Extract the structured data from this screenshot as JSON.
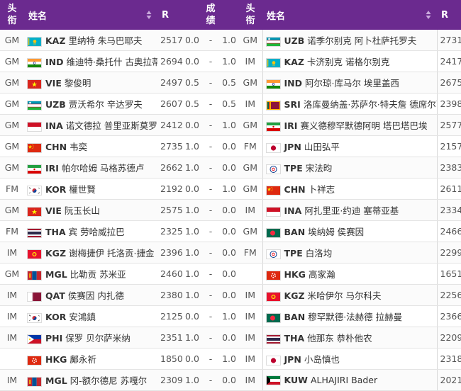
{
  "headers": {
    "title": "头衔",
    "name": "姓名",
    "rating": "R",
    "result": "成绩",
    "title2": "头衔",
    "name2": "姓名",
    "rating2": "R"
  },
  "rows": [
    {
      "w_title": "GM",
      "w_flag": "KAZ",
      "w_code": "KAZ",
      "w_name": "里纳特 朱马巴耶夫",
      "w_rating": "2517",
      "w_score": "0.0",
      "dash": "-",
      "b_score": "1.0",
      "b_title": "GM",
      "b_flag": "UZB",
      "b_code": "UZB",
      "b_name": "诺季尔别克 阿卜杜萨托罗夫",
      "b_rating": "2731"
    },
    {
      "w_title": "GM",
      "w_flag": "IND",
      "w_code": "IND",
      "w_name": "维迪特·桑托什 古奥拉蒂",
      "w_rating": "2694",
      "w_score": "0.0",
      "dash": "-",
      "b_score": "1.0",
      "b_title": "IM",
      "b_flag": "KAZ",
      "b_code": "KAZ",
      "b_name": "卡济别克 诺格尔别克",
      "b_rating": "2417"
    },
    {
      "w_title": "GM",
      "w_flag": "VIE",
      "w_code": "VIE",
      "w_name": "黎俊明",
      "w_rating": "2497",
      "w_score": "0.5",
      "dash": "-",
      "b_score": "0.5",
      "b_title": "GM",
      "b_flag": "IND",
      "b_code": "IND",
      "b_name": "阿尔琼·库马尔 埃里盖西",
      "b_rating": "2675"
    },
    {
      "w_title": "GM",
      "w_flag": "UZB",
      "w_code": "UZB",
      "w_name": "贾沃希尔 辛达罗夫",
      "w_rating": "2607",
      "w_score": "0.5",
      "dash": "-",
      "b_score": "0.5",
      "b_title": "IM",
      "b_flag": "SRI",
      "b_code": "SRI",
      "b_name": "洛库曼纳盖·苏萨尔·特夫詹 德席尔瓦",
      "b_rating": "2398"
    },
    {
      "w_title": "GM",
      "w_flag": "INA",
      "w_code": "INA",
      "w_name": "诺文德拉 普里亚斯莫罗",
      "w_rating": "2412",
      "w_score": "0.0",
      "dash": "-",
      "b_score": "1.0",
      "b_title": "GM",
      "b_flag": "IRI",
      "b_code": "IRI",
      "b_name": "赛义德穆罕默德阿明 塔巴塔巴埃",
      "b_rating": "2577"
    },
    {
      "w_title": "GM",
      "w_flag": "CHN",
      "w_code": "CHN",
      "w_name": "韦奕",
      "w_rating": "2735",
      "w_score": "1.0",
      "dash": "-",
      "b_score": "0.0",
      "b_title": "FM",
      "b_flag": "JPN",
      "b_code": "JPN",
      "b_name": "山田弘平",
      "b_rating": "2157"
    },
    {
      "w_title": "GM",
      "w_flag": "IRI",
      "w_code": "IRI",
      "w_name": "帕尔哈姆 马格苏德卢",
      "w_rating": "2662",
      "w_score": "1.0",
      "dash": "-",
      "b_score": "0.0",
      "b_title": "GM",
      "b_flag": "TPE",
      "b_code": "TPE",
      "b_name": "宋法昀",
      "b_rating": "2383"
    },
    {
      "w_title": "FM",
      "w_flag": "KOR",
      "w_code": "KOR",
      "w_name": "權世賢",
      "w_rating": "2192",
      "w_score": "0.0",
      "dash": "-",
      "b_score": "1.0",
      "b_title": "GM",
      "b_flag": "CHN",
      "b_code": "CHN",
      "b_name": "卜祥志",
      "b_rating": "2611"
    },
    {
      "w_title": "GM",
      "w_flag": "VIE",
      "w_code": "VIE",
      "w_name": "阮玉长山",
      "w_rating": "2575",
      "w_score": "1.0",
      "dash": "-",
      "b_score": "0.0",
      "b_title": "IM",
      "b_flag": "INA",
      "b_code": "INA",
      "b_name": "阿扎里亚·约迪 塞蒂亚基",
      "b_rating": "2334"
    },
    {
      "w_title": "FM",
      "w_flag": "THA",
      "w_code": "THA",
      "w_name": "宾 劳哈威拉巴",
      "w_rating": "2325",
      "w_score": "1.0",
      "dash": "-",
      "b_score": "0.0",
      "b_title": "GM",
      "b_flag": "BAN",
      "b_code": "BAN",
      "b_name": "埃纳姆 侯赛因",
      "b_rating": "2466"
    },
    {
      "w_title": "IM",
      "w_flag": "KGZ",
      "w_code": "KGZ",
      "w_name": "谢梅捷伊 托洛贡·捷金",
      "w_rating": "2396",
      "w_score": "1.0",
      "dash": "-",
      "b_score": "0.0",
      "b_title": "FM",
      "b_flag": "TPE",
      "b_code": "TPE",
      "b_name": "白洛均",
      "b_rating": "2299"
    },
    {
      "w_title": "GM",
      "w_flag": "MGL",
      "w_code": "MGL",
      "w_name": "比勒贡 苏米亚",
      "w_rating": "2460",
      "w_score": "1.0",
      "dash": "-",
      "b_score": "0.0",
      "b_title": "",
      "b_flag": "HKG",
      "b_code": "HKG",
      "b_name": "高家瀚",
      "b_rating": "1651"
    },
    {
      "w_title": "IM",
      "w_flag": "QAT",
      "w_code": "QAT",
      "w_name": "侯赛因 内扎德",
      "w_rating": "2380",
      "w_score": "1.0",
      "dash": "-",
      "b_score": "0.0",
      "b_title": "IM",
      "b_flag": "KGZ",
      "b_code": "KGZ",
      "b_name": "米哈伊尔 马尔科夫",
      "b_rating": "2256"
    },
    {
      "w_title": "IM",
      "w_flag": "KOR",
      "w_code": "KOR",
      "w_name": "安鴻鎮",
      "w_rating": "2125",
      "w_score": "0.0",
      "dash": "-",
      "b_score": "1.0",
      "b_title": "IM",
      "b_flag": "BAN",
      "b_code": "BAN",
      "b_name": "穆罕默德·法赫德 拉赫曼",
      "b_rating": "2366"
    },
    {
      "w_title": "IM",
      "w_flag": "PHI",
      "w_code": "PHI",
      "w_name": "保罗 贝尔萨米纳",
      "w_rating": "2351",
      "w_score": "1.0",
      "dash": "-",
      "b_score": "0.0",
      "b_title": "IM",
      "b_flag": "THA",
      "b_code": "THA",
      "b_name": "他那东 恭朴他农",
      "b_rating": "2209"
    },
    {
      "w_title": "",
      "w_flag": "HKG",
      "w_code": "HKG",
      "w_name": "鄺永祈",
      "w_rating": "1850",
      "w_score": "0.0",
      "dash": "-",
      "b_score": "1.0",
      "b_title": "IM",
      "b_flag": "JPN",
      "b_code": "JPN",
      "b_name": "小岛慎也",
      "b_rating": "2318"
    },
    {
      "w_title": "IM",
      "w_flag": "MGL",
      "w_code": "MGL",
      "w_name": "冈-额尔德尼 苏嘎尔",
      "w_rating": "2309",
      "w_score": "1.0",
      "dash": "-",
      "b_score": "0.0",
      "b_title": "IM",
      "b_flag": "KUW",
      "b_code": "KUW",
      "b_name": "ALHAJIRI Bader",
      "b_rating": "2021"
    }
  ],
  "colors": {
    "header_bg": "#6b2a8f",
    "header_text": "#ffffff"
  }
}
